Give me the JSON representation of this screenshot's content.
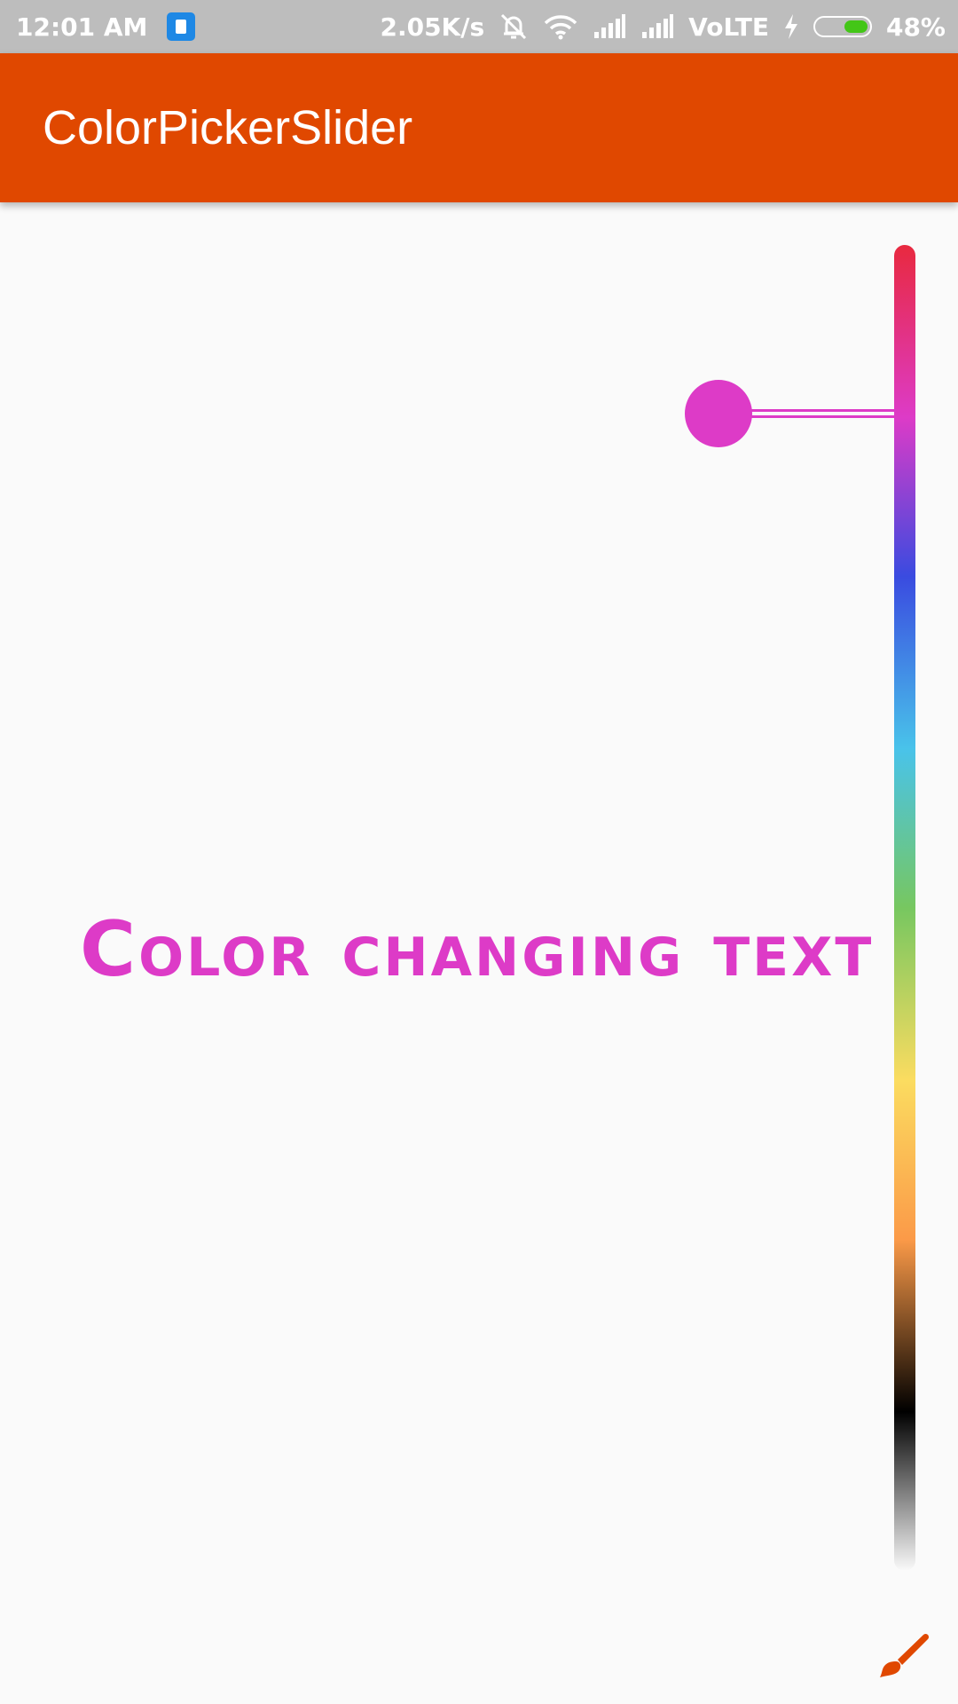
{
  "status_bar": {
    "time": "12:01 AM",
    "speed": "2.05K/s",
    "network": "VoLTE",
    "battery_percent": "48%",
    "battery_level": 0.48,
    "icons": [
      "app-notification-icon",
      "alarm-off-icon",
      "wifi-icon",
      "signal-icon",
      "signal-icon",
      "charging-icon",
      "battery-icon"
    ]
  },
  "app_bar": {
    "title": "ColorPickerSlider",
    "color": "#e04800"
  },
  "content": {
    "colored_text": "Color changing text",
    "text_color": "#dd3bc7"
  },
  "slider": {
    "selected_color": "#dd3bc7",
    "value": 0.127,
    "gradient_stops": [
      "#e8293f",
      "#dd3bc7",
      "#3a4be0",
      "#49c3ea",
      "#77c760",
      "#fbdc60",
      "#fb9a48",
      "#000000",
      "#ffffff"
    ]
  },
  "fab": {
    "icon": "brush-icon",
    "color": "#e04800"
  }
}
